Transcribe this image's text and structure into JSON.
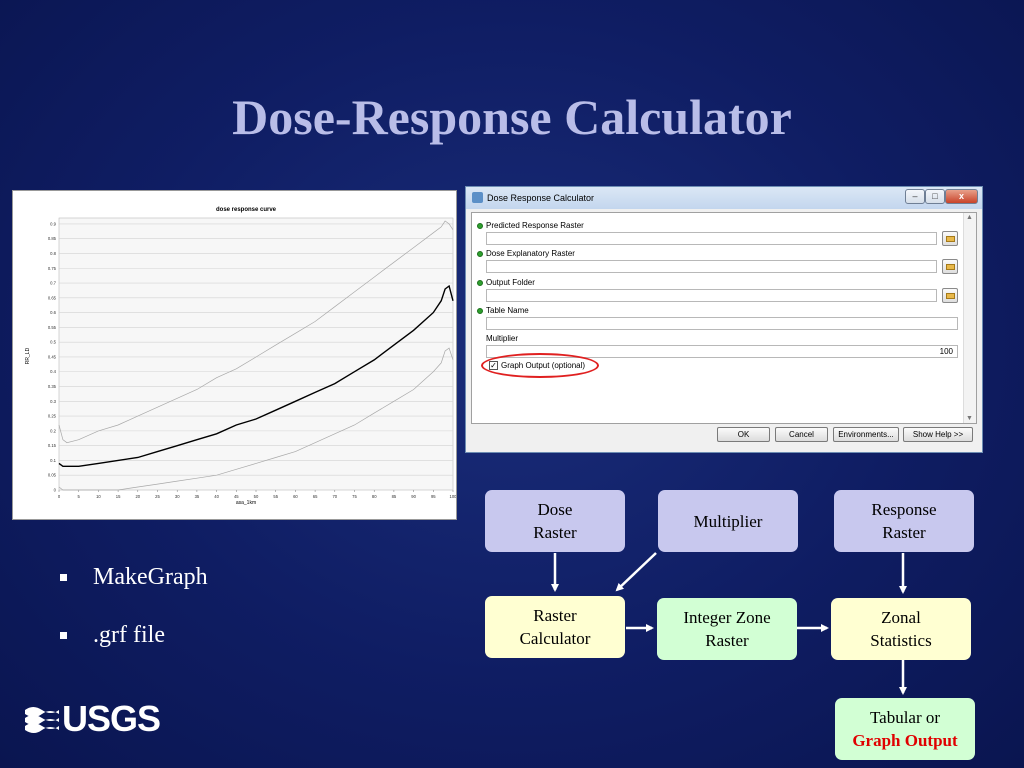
{
  "slide": {
    "title": "Dose-Response Calculator"
  },
  "chart": {
    "title": "dose response curve",
    "xlabel": "asa_1km",
    "ylabel": "RR_LD",
    "y_ticks": [
      "0.9",
      "0.85",
      "0.8",
      "0.75",
      "0.7",
      "0.65",
      "0.6",
      "0.55",
      "0.5",
      "0.45",
      "0.4",
      "0.35",
      "0.3",
      "0.25",
      "0.2",
      "0.15",
      "0.1",
      "0.05",
      "0"
    ],
    "x_ticks": [
      "0",
      "5",
      "10",
      "15",
      "20",
      "25",
      "30",
      "35",
      "40",
      "45",
      "50",
      "55",
      "60",
      "65",
      "70",
      "75",
      "80",
      "85",
      "90",
      "95",
      "100"
    ]
  },
  "chart_data": {
    "type": "line",
    "title": "dose response curve",
    "xlabel": "asa_1km",
    "ylabel": "RR_LD",
    "xlim": [
      0,
      100
    ],
    "ylim": [
      0,
      0.92
    ],
    "grid": true,
    "x": [
      0,
      1,
      2,
      5,
      10,
      15,
      20,
      25,
      30,
      35,
      40,
      45,
      50,
      55,
      60,
      65,
      70,
      75,
      80,
      85,
      90,
      95,
      97,
      98,
      99,
      100
    ],
    "series": [
      {
        "values": [
          0.22,
          0.17,
          0.16,
          0.17,
          0.2,
          0.22,
          0.25,
          0.28,
          0.31,
          0.34,
          0.38,
          0.41,
          0.45,
          0.49,
          0.53,
          0.57,
          0.62,
          0.67,
          0.72,
          0.77,
          0.82,
          0.87,
          0.89,
          0.91,
          0.9,
          0.88
        ]
      },
      {
        "values": [
          0.09,
          0.08,
          0.08,
          0.08,
          0.09,
          0.1,
          0.11,
          0.13,
          0.15,
          0.17,
          0.19,
          0.22,
          0.24,
          0.27,
          0.3,
          0.33,
          0.36,
          0.4,
          0.44,
          0.49,
          0.54,
          0.6,
          0.64,
          0.68,
          0.69,
          0.64
        ]
      },
      {
        "values": [
          0.01,
          0.0,
          0.0,
          0.0,
          0.0,
          0.0,
          0.01,
          0.02,
          0.03,
          0.04,
          0.05,
          0.07,
          0.09,
          0.11,
          0.13,
          0.16,
          0.19,
          0.22,
          0.26,
          0.3,
          0.34,
          0.4,
          0.43,
          0.47,
          0.48,
          0.44
        ]
      }
    ]
  },
  "dialog": {
    "title": "Dose Response Calculator",
    "win_min": "–",
    "win_max": "□",
    "win_close": "x",
    "scroll_up": "▲",
    "scroll_down": "▼",
    "params": {
      "predicted_response_raster": {
        "label": "Predicted Response Raster",
        "value": ""
      },
      "dose_explanatory_raster": {
        "label": "Dose Explanatory Raster",
        "value": ""
      },
      "output_folder": {
        "label": "Output Folder",
        "value": ""
      },
      "table_name": {
        "label": "Table Name",
        "value": ""
      },
      "multiplier": {
        "label": "Multiplier",
        "value": "100"
      },
      "graph_output": {
        "label": "Graph Output (optional)",
        "checked": true,
        "check_mark": "✓"
      }
    },
    "buttons": {
      "ok": "OK",
      "cancel": "Cancel",
      "environments": "Environments...",
      "show_help": "Show Help >>"
    }
  },
  "bullets": [
    {
      "text": "MakeGraph"
    },
    {
      "text": ".grf file"
    }
  ],
  "logo": {
    "text": "USGS"
  },
  "flowchart": {
    "dose_raster": [
      "Dose",
      "Raster"
    ],
    "multiplier": "Multiplier",
    "response_raster": [
      "Response",
      "Raster"
    ],
    "raster_calculator": [
      "Raster",
      "Calculator"
    ],
    "integer_zone_raster": [
      "Integer Zone",
      "Raster"
    ],
    "zonal_statistics": [
      "Zonal",
      "Statistics"
    ],
    "output": {
      "line1": "Tabular or",
      "line2": "Graph Output"
    }
  },
  "colors": {
    "background": "#0f1d63",
    "title": "#b9bde8",
    "box_lavender": "#c8c8ee",
    "box_yellow": "#ffffd2",
    "box_green": "#d2ffd4",
    "highlight_red": "#e00000"
  }
}
